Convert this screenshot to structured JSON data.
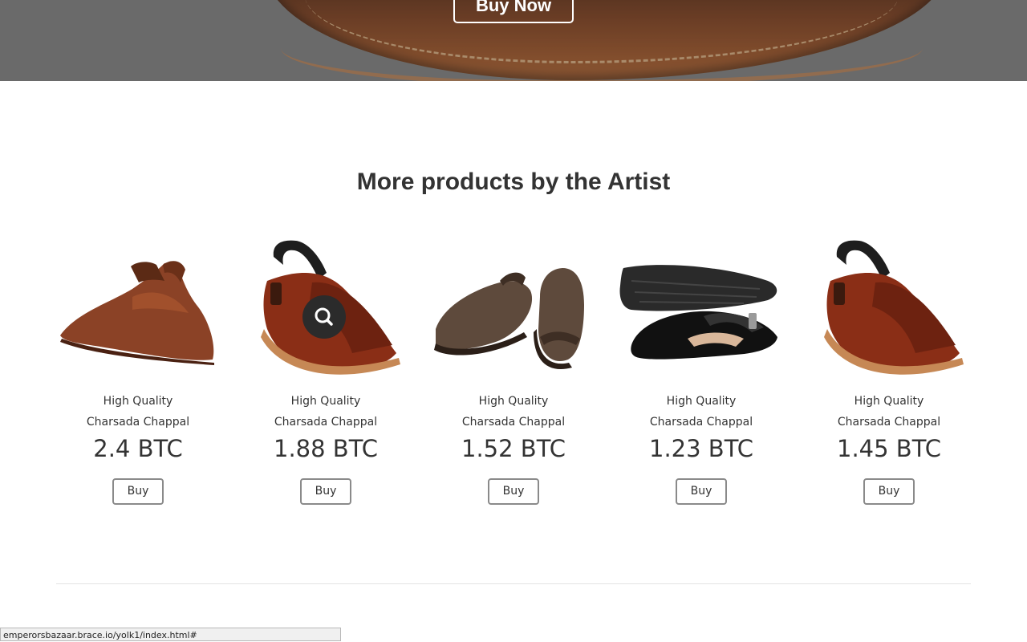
{
  "hero": {
    "button_label": "Buy Now"
  },
  "section": {
    "title": "More products by the Artist"
  },
  "products": [
    {
      "name": "High Quality Charsada Chappal",
      "price": "2.4 BTC",
      "buy_label": "Buy",
      "image": "brown-leather-sandal-image"
    },
    {
      "name": "High Quality Charsada Chappal",
      "price": "1.88 BTC",
      "buy_label": "Buy",
      "image": "red-brown-textured-sandal-image"
    },
    {
      "name": "High Quality Charsada Chappal",
      "price": "1.52 BTC",
      "buy_label": "Buy",
      "image": "dark-brown-sandal-pair-image"
    },
    {
      "name": "High Quality Charsada Chappal",
      "price": "1.23 BTC",
      "buy_label": "Buy",
      "image": "black-sandal-pair-image"
    },
    {
      "name": "High Quality Charsada Chappal",
      "price": "1.45 BTC",
      "buy_label": "Buy",
      "image": "red-brown-textured-sandal-image"
    }
  ],
  "status_bar": {
    "url": "emperorsbazaar.brace.io/yolk1/index.html#"
  },
  "icons": {
    "zoom": "search-icon"
  },
  "colors": {
    "text": "#333333",
    "button_border": "#8a8a8a",
    "leather": "#7a3e1e"
  }
}
